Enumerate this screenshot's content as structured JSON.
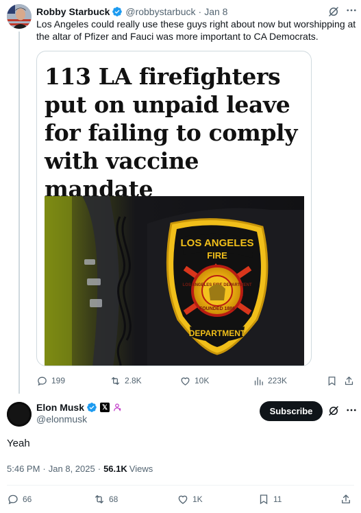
{
  "parent_tweet": {
    "author_name": "Robby Starbuck",
    "handle": "@robbystarbuck",
    "separator": "·",
    "date": "Jan 8",
    "text": "Los Angeles could really use these guys right about now but worshipping at the altar of Pfizer and Fauci was more important to CA Democrats.",
    "media": {
      "headline": "113 LA firefighters put on unpaid leave for failing to comply with vaccine mandate",
      "patch_top": "LOS ANGELES",
      "patch_middle": "FIRE",
      "patch_ring": "LOS ANGELES FIRE DEPARTMENT",
      "patch_founded": "FOUNDED 1886",
      "patch_bottom": "DEPARTMENT"
    },
    "actions": {
      "replies": "199",
      "reposts": "2.8K",
      "likes": "10K",
      "views": "223K"
    }
  },
  "main_tweet": {
    "author_name": "Elon Musk",
    "handle": "@elonmusk",
    "subscribe_label": "Subscribe",
    "text": "Yeah",
    "time": "5:46 PM",
    "date": "Jan 8, 2025",
    "meta_sep1": "·",
    "meta_sep2": "·",
    "views_count": "56.1K",
    "views_label": "Views",
    "actions": {
      "replies": "66",
      "reposts": "68",
      "likes": "1K",
      "bookmarks": "11"
    }
  },
  "colors": {
    "verified_blue": "#1d9bf0",
    "muted_text": "#536471",
    "primary_text": "#0f1419",
    "org_badge": "#c13bc8"
  },
  "icons": [
    "grok-icon",
    "more-icon",
    "reply-icon",
    "repost-icon",
    "like-icon",
    "views-icon",
    "bookmark-icon",
    "share-icon",
    "verified-icon",
    "x-badge-icon",
    "org-badge-icon"
  ]
}
